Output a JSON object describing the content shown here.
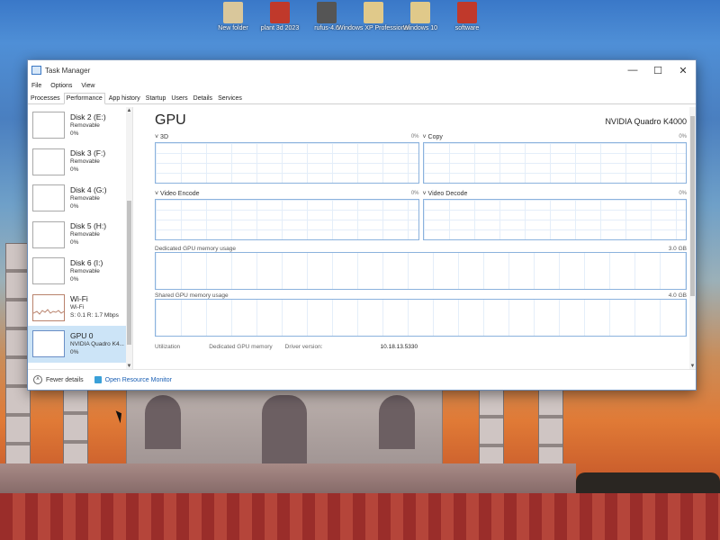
{
  "desktop": {
    "icons": [
      {
        "label": "New folder",
        "color": "#d9c79b"
      },
      {
        "label": "plant 3d 2023",
        "color": "#c0392b"
      },
      {
        "label": "rufus-4.6",
        "color": "#555555"
      },
      {
        "label": "Windows XP Professional",
        "color": "#e0c98a"
      },
      {
        "label": "Windows 10",
        "color": "#e0c98a"
      },
      {
        "label": "software",
        "color": "#c0392b"
      }
    ]
  },
  "window": {
    "title": "Task Manager",
    "controls": {
      "minimize": "—",
      "maximize": "☐",
      "close": "✕"
    }
  },
  "menu": [
    "File",
    "Options",
    "View"
  ],
  "tabs": [
    "Processes",
    "Performance",
    "App history",
    "Startup",
    "Users",
    "Details",
    "Services"
  ],
  "sidebar": {
    "items": [
      {
        "name": "Disk 2 (E:)",
        "sub1": "Removable",
        "sub2": "0%"
      },
      {
        "name": "Disk 3 (F:)",
        "sub1": "Removable",
        "sub2": "0%"
      },
      {
        "name": "Disk 4 (G:)",
        "sub1": "Removable",
        "sub2": "0%"
      },
      {
        "name": "Disk 5 (H:)",
        "sub1": "Removable",
        "sub2": "0%"
      },
      {
        "name": "Disk 6 (I:)",
        "sub1": "Removable",
        "sub2": "0%"
      },
      {
        "name": "Wi-Fi",
        "sub1": "Wi-Fi",
        "sub2": "S: 0.1  R: 1.7 Mbps"
      },
      {
        "name": "GPU 0",
        "sub1": "NVIDIA Quadro K4...",
        "sub2": "0%"
      }
    ]
  },
  "gpu": {
    "title": "GPU",
    "model": "NVIDIA Quadro K4000",
    "graphs": [
      {
        "label": "3D",
        "percent": "0%"
      },
      {
        "label": "Copy",
        "percent": "0%"
      },
      {
        "label": "Video Encode",
        "percent": "0%"
      },
      {
        "label": "Video Decode",
        "percent": "0%"
      }
    ],
    "dedicated_memory": {
      "label": "Dedicated GPU memory usage",
      "max": "3.0 GB"
    },
    "shared_memory": {
      "label": "Shared GPU memory usage",
      "max": "4.0 GB"
    },
    "stats": {
      "utilization_label": "Utilization",
      "dedicated_label": "Dedicated GPU memory",
      "driver_label": "Driver version:",
      "driver_value": "10.18.13.5330"
    }
  },
  "footer": {
    "fewer_details": "Fewer details",
    "open_resource_monitor": "Open Resource Monitor"
  },
  "colors": {
    "accent": "#1a5fb4",
    "graph_border": "#8bb2dd",
    "selection": "#cce4f7"
  }
}
